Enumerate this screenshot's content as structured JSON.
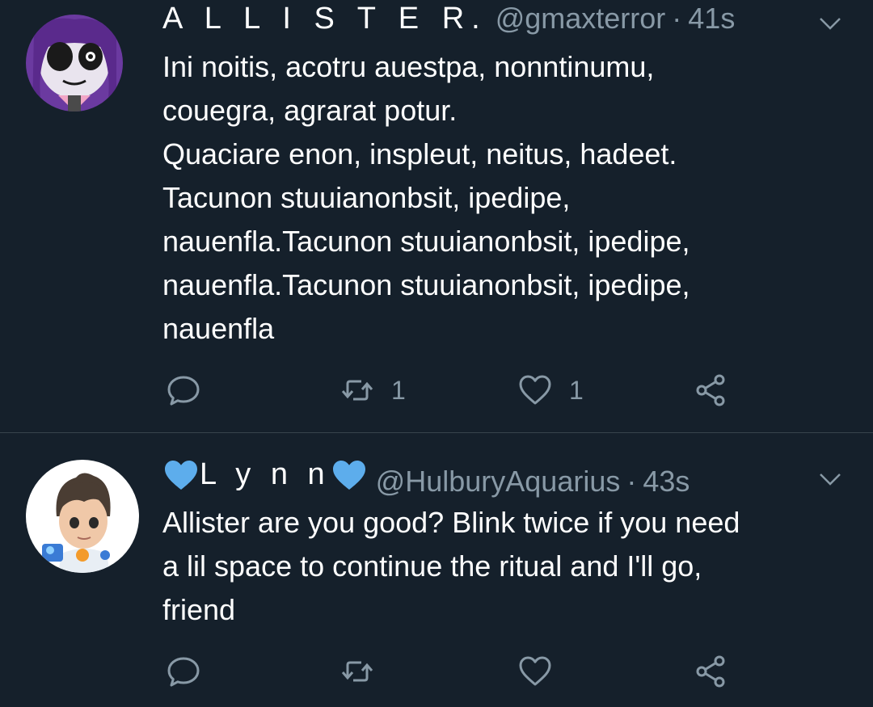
{
  "tweets": [
    {
      "display_name": "A L L I S T E R.",
      "handle": "@gmaxterror",
      "separator": "·",
      "time": "41s",
      "text_lines": [
        "Ini noitis, acotru auestpa, nonntinumu,",
        "couegra, agrarat potur.",
        "Quaciare enon, inspleut, neitus, hadeet.",
        "Tacunon stuuianonbsit, ipedipe,",
        "nauenfla.Tacunon stuuianonbsit, ipedipe,",
        "nauenfla.Tacunon stuuianonbsit, ipedipe,",
        "nauenfla"
      ],
      "retweets": "1",
      "likes": "1"
    },
    {
      "display_name": "L y n n",
      "handle": "@HulburyAquarius",
      "separator": "·",
      "time": "43s",
      "text_lines": [
        "Allister are you good? Blink twice if you need",
        "a lil space to continue the ritual and I'll go,",
        "friend"
      ]
    }
  ],
  "colors": {
    "background": "#15202b",
    "text": "#ffffff",
    "muted": "#8899a6",
    "divider": "#38444d",
    "heart_badge": "#5dadec"
  },
  "icons": {
    "reply": "speech-bubble-icon",
    "retweet": "retweet-arrows-icon",
    "like": "heart-outline-icon",
    "share": "share-nodes-icon",
    "menu": "chevron-down-icon"
  }
}
